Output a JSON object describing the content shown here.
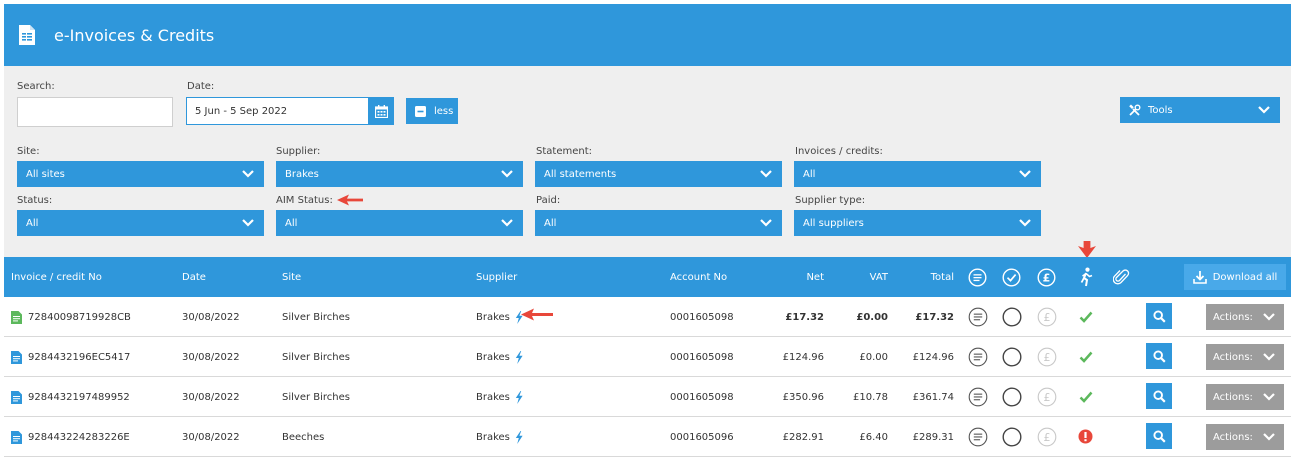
{
  "header": {
    "title": "e-Invoices & Credits",
    "icon": "document-icon"
  },
  "filters": {
    "search": {
      "label": "Search:",
      "value": "",
      "placeholder": ""
    },
    "date": {
      "label": "Date:",
      "value": "5 Jun - 5 Sep 2022"
    },
    "less_button": "less",
    "tools_button": "Tools",
    "site": {
      "label": "Site:",
      "value": "All sites"
    },
    "supplier": {
      "label": "Supplier:",
      "value": "Brakes"
    },
    "statement": {
      "label": "Statement:",
      "value": "All statements"
    },
    "invoices_credits": {
      "label": "Invoices / credits:",
      "value": "All"
    },
    "status": {
      "label": "Status:",
      "value": "All"
    },
    "aim_status": {
      "label": "AIM Status:",
      "value": "All"
    },
    "paid": {
      "label": "Paid:",
      "value": "All"
    },
    "supplier_type": {
      "label": "Supplier type:",
      "value": "All suppliers"
    }
  },
  "table": {
    "headers": {
      "invoice_no": "Invoice / credit No",
      "date": "Date",
      "site": "Site",
      "supplier": "Supplier",
      "account_no": "Account No",
      "net": "Net",
      "vat": "VAT",
      "total": "Total",
      "download_all": "Download all"
    },
    "rows": [
      {
        "invoice_no": "72840098719928CB",
        "date": "30/08/2022",
        "site": "Silver Birches",
        "supplier": "Brakes",
        "account_no": "0001605098",
        "net": "£17.32",
        "vat": "£0.00",
        "total": "£17.32",
        "actions": "Actions:",
        "doc_color": "#5cb85c",
        "aim_status": "ok"
      },
      {
        "invoice_no": "9284432196EC5417",
        "date": "30/08/2022",
        "site": "Silver Birches",
        "supplier": "Brakes",
        "account_no": "0001605098",
        "net": "£124.96",
        "vat": "£0.00",
        "total": "£124.96",
        "actions": "Actions:",
        "doc_color": "#2f97db",
        "aim_status": "ok"
      },
      {
        "invoice_no": "9284432197489952",
        "date": "30/08/2022",
        "site": "Silver Birches",
        "supplier": "Brakes",
        "account_no": "0001605098",
        "net": "£350.96",
        "vat": "£10.78",
        "total": "£361.74",
        "actions": "Actions:",
        "doc_color": "#2f97db",
        "aim_status": "ok"
      },
      {
        "invoice_no": "928443224283226E",
        "date": "30/08/2022",
        "site": "Beeches",
        "supplier": "Brakes",
        "account_no": "0001605096",
        "net": "£282.91",
        "vat": "£6.40",
        "total": "£289.31",
        "actions": "Actions:",
        "doc_color": "#2f97db",
        "aim_status": "error"
      }
    ]
  },
  "colors": {
    "accent": "#2f97db",
    "ok": "#5cb85c",
    "error": "#e8473a",
    "actions": "#9c9c9c",
    "annotation_arrow": "#e8473a"
  }
}
